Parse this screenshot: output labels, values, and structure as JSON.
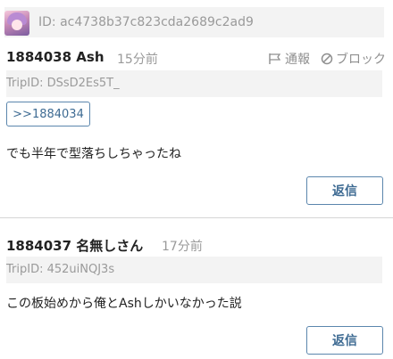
{
  "header": {
    "user_id": "ID: ac4738b37c823cda2689c2ad9",
    "avatar_icon": "anime-avatar-icon"
  },
  "posts": [
    {
      "number_name": "1884038 Ash",
      "time": "15分前",
      "report_label": "通報",
      "block_label": "ブロック",
      "trip_id": "TripID: DSsD2Es5T_",
      "anchor": ">>1884034",
      "body": "でも半年で型落ちしちゃったね",
      "reply_label": "返信"
    },
    {
      "number_name": "1884037 名無しさん",
      "time": "17分前",
      "trip_id": "TripID: 452uiNQJ3s",
      "body": "この板始めから俺とAshしかいなかった説",
      "reply_label": "返信"
    }
  ],
  "icons": {
    "report": "flag-icon",
    "block": "block-icon"
  },
  "colors": {
    "accent": "#3e6b93",
    "muted_text": "#9a9a9a",
    "panel_bg": "#f3f3f3"
  }
}
